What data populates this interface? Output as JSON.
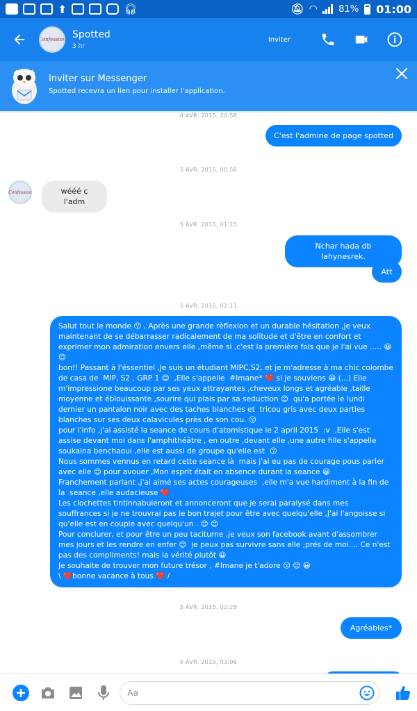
{
  "status_bar": {
    "battery": "81%",
    "time": "01:00"
  },
  "header": {
    "name": "Spotted",
    "subtitle": "3 hr",
    "invite_label": "Inviter"
  },
  "banner": {
    "title": "Inviter sur Messenger",
    "text": "Spotted recevra un lien pour installer l'application."
  },
  "avatar_text": "Confession",
  "messages": [
    {
      "time": "4 AVR. 2015, 20:58"
    },
    {
      "text": "C'est l'admine de page spotted"
    },
    {
      "time": "5 AVR. 2015, 00:56"
    },
    {
      "text": "wééé c l'adm"
    },
    {
      "time": "5 AVR. 2015, 01:15"
    },
    {
      "text": "Nchar hada db lahynesrek."
    },
    {
      "text": "Att"
    },
    {
      "time": "5 AVR. 2015, 02:11"
    },
    {
      "text": "Salut tout le monde 😗 , Après une grande rèflexion et un durable hésitation ,je veux maintenant de se débarrasser radicalement de ma solitude et d'être en confort et exprimer mon admiration envers elle ,même si ,c'est la première fois que je l'ai vue ..... 😀 😊\nbon!! Passant à l'éssentiel ,Je suis un étudiant MIPC,S2, et je m'adresse à ma chic colombe de casa de  MIP, S2 , GRP 1 😊  ,Elle s'appelle  #Imane* ❤️ si je souviens 😀 (...) Elle m'impressione beaucoup par ses yeux attrayantes ,cheveux longs et agréable ,taille moyenne et éblouissante ,sourire qui plais par sa seduction 😊  qu'a portée le lundi dernier un pantalon noir avec des taches blanches et  tricou gris avec deux parties blanches sur ses deux calavicules près de son cou. 😗\npour l'info ,j'ai assisté la seance de cours d'atomistique le 2 april 2015  :v  ,Elle s'est assise devant moi dans l'amphithéâtre , en outre ,devant elle ,une autre fille s'appelle soukaina benchaoui ,elle est aussi de groupe qu'elle est  😗\nNous sommes vennus en retard cette seance là  mais j'ai eu pas de courage pous parler avec elle 😊 pour avouer ,Mon esprit était en absence durant la seance 😀\nFranchement parlant ,j'ai aimé ses actes courageuses  ,elle m'a vue hardiment à la fin de la  seance ,elle audacieuse ❤️\nLes clochettes tintinnabuleront et annonceront que je serai paralysé dans mes souffrances si je ne trouvrai pas le bon trajet pour être avec quelqu'elle ,J'ai l'angoisse si qu'elle est en couple avec quelqu'un . 😊 😊\nPour conclurer, et pour être un peu taciturne ,je veux son facebook avant d'assombrer mes jours et les rendre en enfer 😊  je peux pas survivre sans elle ,prés de moi.... Ce n'est pas des compliments! mais la vérité plutôt 😀\nJe souhaite de trouver mon future trésor , #Imane je t'adore 😗 😊 😀\n\\ ❤️bonne vacance à tous ❤️ /"
    },
    {
      "time": "5 AVR. 2015, 02:28"
    },
    {
      "text": "Agréables*"
    },
    {
      "time": "5 AVR. 2015, 03:06"
    }
  ],
  "composer": {
    "placeholder": "Aa"
  },
  "colors": {
    "header": "#1782ee",
    "status_bar": "#0a63c9",
    "banner": "#2c8ff3",
    "outgoing": "#0c84ff",
    "incoming": "#ebebeb"
  }
}
